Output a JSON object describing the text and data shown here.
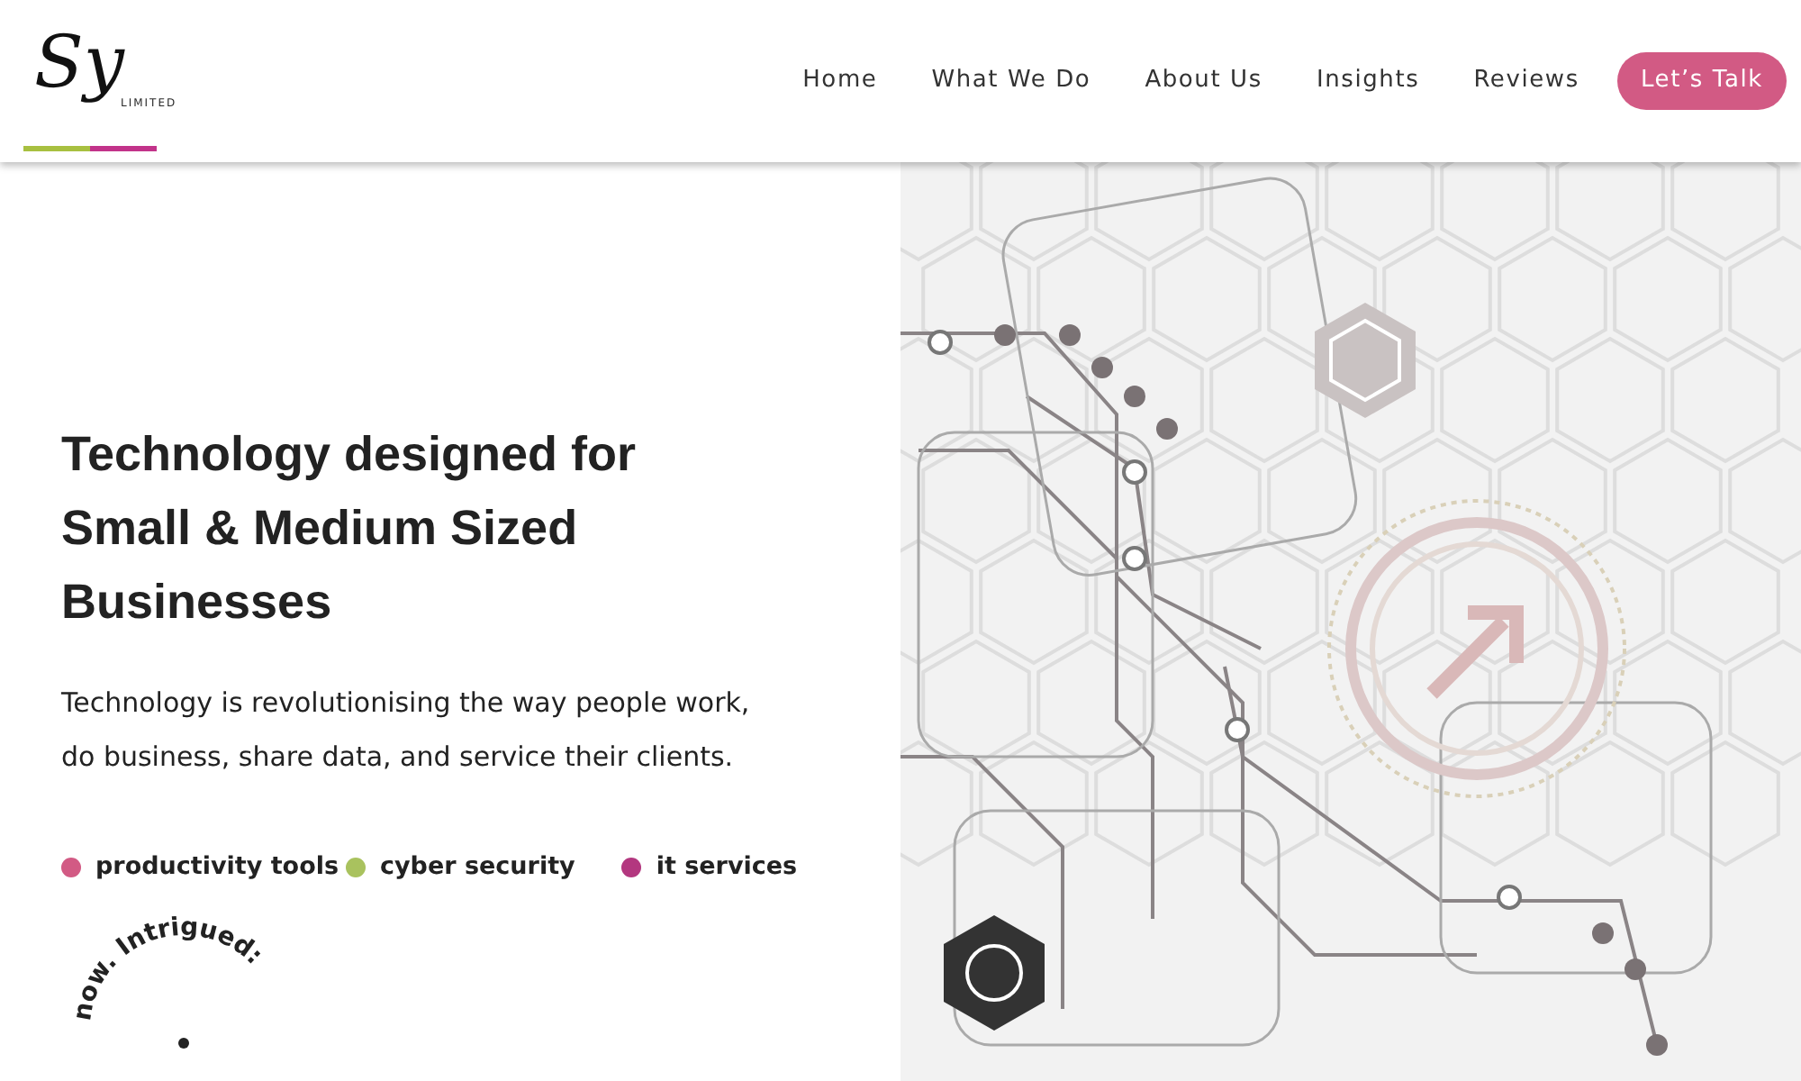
{
  "logo": {
    "monogram": "Sy",
    "subtitle": "LIMITED"
  },
  "nav": {
    "links": [
      {
        "label": "Home"
      },
      {
        "label": "What We Do"
      },
      {
        "label": "About Us"
      },
      {
        "label": "Insights"
      },
      {
        "label": "Reviews"
      }
    ],
    "cta": "Let’s Talk"
  },
  "hero": {
    "heading": "Technology designed for Small & Medium Sized Businesses",
    "text": "Technology is revolutionising the way people work, do business, share data, and service their clients.",
    "tags": [
      {
        "label": "productivity tools",
        "color": "#d25a84"
      },
      {
        "label": "cyber security",
        "color": "#a9c25e"
      },
      {
        "label": "it services",
        "color": "#b3377f"
      }
    ],
    "circle_text": "now. Intrigued:"
  }
}
